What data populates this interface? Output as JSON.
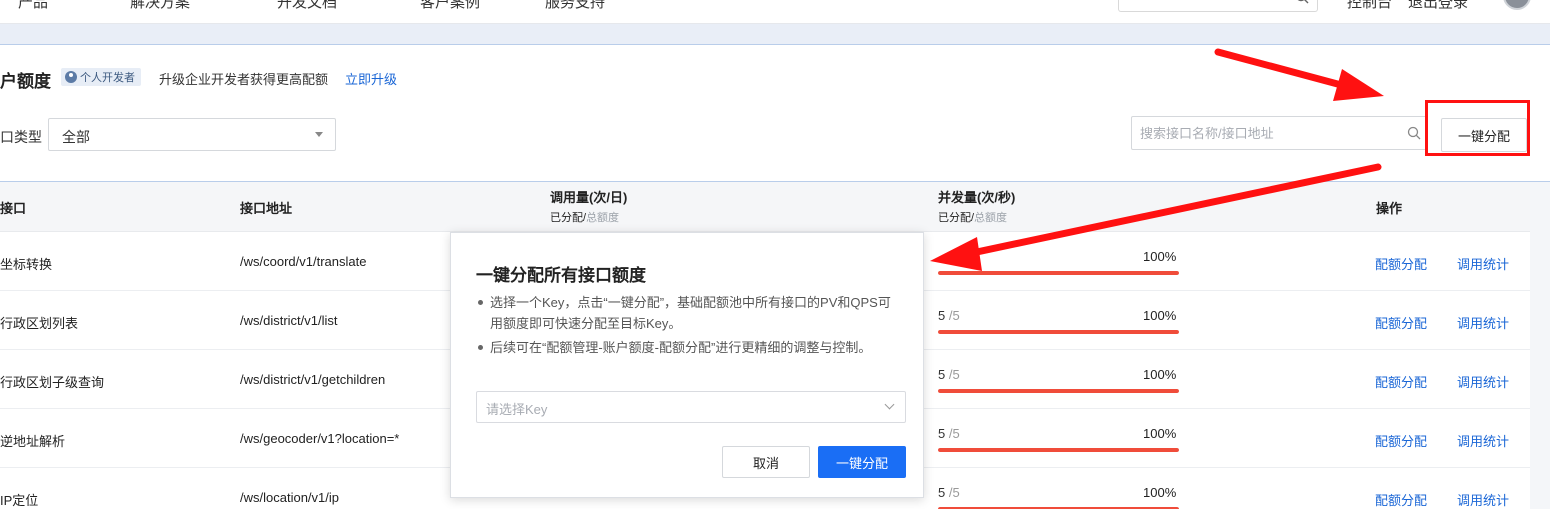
{
  "topnav": {
    "items": [
      "产品",
      "解决方案",
      "开发文档",
      "客户案例",
      "服务支持"
    ],
    "right_items": [
      "控制台",
      "退出登录"
    ]
  },
  "quota": {
    "title": "户额度",
    "badge": "个人开发者",
    "upgrade_text": "升级企业开发者获得更高配额",
    "upgrade_link": "立即升级",
    "filter_label": "口类型",
    "filter_value": "全部",
    "search_placeholder": "搜索接口名称/接口地址",
    "one_click_button": "一键分配"
  },
  "table": {
    "headers": {
      "api": "接口",
      "address": "接口地址",
      "calls": "调用量(次/日)",
      "calls_sub_a": "已分配/",
      "calls_sub_b": "总额度",
      "concurrency": "并发量(次/秒)",
      "conc_sub_a": "已分配/",
      "conc_sub_b": "总额度",
      "ops": "操作"
    },
    "rows": [
      {
        "name": "坐标转换",
        "address": "/ws/coord/v1/translate",
        "allocated": "5",
        "total": "/5",
        "percent": "100%",
        "fill": 1.0
      },
      {
        "name": "行政区划列表",
        "address": "/ws/district/v1/list",
        "allocated": "5",
        "total": "/5",
        "percent": "100%",
        "fill": 1.0
      },
      {
        "name": "行政区划子级查询",
        "address": "/ws/district/v1/getchildren",
        "allocated": "5",
        "total": "/5",
        "percent": "100%",
        "fill": 1.0
      },
      {
        "name": "逆地址解析",
        "address": "/ws/geocoder/v1?location=*",
        "allocated": "5",
        "total": "/5",
        "percent": "100%",
        "fill": 1.0
      },
      {
        "name": "IP定位",
        "address": "/ws/location/v1/ip",
        "allocated": "5",
        "total": "/5",
        "percent": "100%",
        "fill": 1.0
      }
    ],
    "op_allocate": "配额分配",
    "op_stats": "调用统计"
  },
  "modal": {
    "title": "一键分配所有接口额度",
    "bullet1": "选择一个Key，点击“一键分配”，基础配额池中所有接口的PV和QPS可用额度即可快速分配至目标Key。",
    "bullet2": "后续可在“配额管理-账户额度-配额分配”进行更精细的调整与控制。",
    "select_placeholder": "请选择Key",
    "cancel": "取消",
    "confirm": "一键分配"
  },
  "colors": {
    "accent": "#1a6ef5",
    "link": "#1a66d6",
    "progress": "#f04c3a",
    "annotation": "#ff1111"
  }
}
